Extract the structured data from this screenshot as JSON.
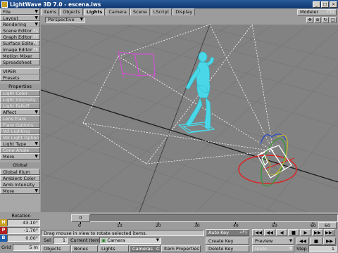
{
  "window": {
    "title": "LightWave 3D 7.0 - escena.lws",
    "buttons": [
      "_",
      "□",
      "×"
    ]
  },
  "left_panel": {
    "items": [
      {
        "label": "File",
        "arrow": "▼",
        "disabled": false
      },
      {
        "label": "Layout",
        "arrow": "▼",
        "disabled": false
      },
      {
        "label": "Rendering",
        "arrow": "▼",
        "disabled": false
      },
      {
        "label": "Scene Editor",
        "key": "F1",
        "disabled": false
      },
      {
        "label": "Graph Editor",
        "key": "F2",
        "disabled": false
      },
      {
        "label": "Surface Editor",
        "key": "F5",
        "disabled": false
      },
      {
        "label": "Image Editor",
        "key": "F6",
        "disabled": false
      },
      {
        "label": "Motion Mixer",
        "disabled": false
      },
      {
        "label": "Spreadsheet",
        "disabled": false
      }
    ],
    "items2": [
      {
        "label": "VIPER",
        "disabled": false
      },
      {
        "label": "Presets",
        "disabled": false
      }
    ],
    "properties_heading": "Properties",
    "props": [
      {
        "label": "Light Color",
        "disabled": true
      },
      {
        "label": "Light Intensity",
        "disabled": true
      },
      {
        "label": "Light Falloff",
        "disabled": true
      },
      {
        "label": "Affect",
        "arrow": "▼",
        "disabled": false
      },
      {
        "label": "Lens Flare",
        "disabled": true
      },
      {
        "label": "Flare Options",
        "disabled": true
      },
      {
        "label": "Vol Lighting",
        "disabled": true
      },
      {
        "label": "Vol Light Options",
        "disabled": true
      },
      {
        "label": "Light Type",
        "arrow": "▼",
        "disabled": false
      },
      {
        "label": "Cone Angle",
        "disabled": true
      },
      {
        "label": "More",
        "arrow": "▼",
        "disabled": false
      }
    ],
    "global_heading": "Global",
    "global": [
      {
        "label": "Global Illum",
        "disabled": false
      },
      {
        "label": "Ambient Color",
        "disabled": false
      },
      {
        "label": "Amb Intensity",
        "disabled": false
      },
      {
        "label": "More",
        "arrow": "▼",
        "disabled": false
      }
    ]
  },
  "tabs": [
    {
      "label": "Items",
      "active": false
    },
    {
      "label": "Objects",
      "active": false
    },
    {
      "label": "Lights",
      "active": true
    },
    {
      "label": "Camera",
      "active": false
    },
    {
      "label": "Scene",
      "active": false
    },
    {
      "label": "LScript",
      "active": false
    },
    {
      "label": "Display",
      "active": false
    }
  ],
  "modeler": {
    "label": "Modeler",
    "key": "F12"
  },
  "viewport": {
    "view_mode": "Perspective",
    "view_controls": [
      "move-icon",
      "zoom-icon",
      "rotate-icon",
      "maximize-icon"
    ],
    "view_glyphs": [
      "✥",
      "⊕",
      "↻",
      "□"
    ]
  },
  "timeline": {
    "rotation_label": "Rotation",
    "coords": [
      {
        "key": "H",
        "value": "43.10°",
        "color": "#c8a020"
      },
      {
        "key": "P",
        "value": "-1.70°",
        "color": "#b02020"
      },
      {
        "key": "B",
        "value": "0.00°",
        "color": "#2060b0"
      }
    ],
    "grid_label": "Grid",
    "grid_value": "5 m",
    "current_frame": "0",
    "ticks": [
      "0",
      "10",
      "20",
      "30",
      "40",
      "50",
      "60"
    ],
    "end_frame": "60",
    "status_text": "Drag mouse in view to rotate selected items.",
    "sel_label": "Sel:",
    "sel_value": "1",
    "current_item_label": "Current Item",
    "current_item_value": "Camera",
    "item_type_buttons": [
      {
        "label": "Objects",
        "active": false
      },
      {
        "label": "Bones",
        "active": false
      },
      {
        "label": "Lights",
        "active": false
      },
      {
        "label": "Cameras",
        "active": true
      }
    ],
    "cameras_key": "C",
    "item_properties": "Item Properties",
    "auto_key": "Auto Key",
    "auto_key_shortcut": "+F1",
    "create_key": "Create Key",
    "delete_key": "Delete Key",
    "preview": "Preview",
    "undo": "Undo",
    "step_label": "Step",
    "step_value": "1",
    "transport": [
      "|◀◀",
      "◀◀",
      "◀",
      "■",
      "▶",
      "▶▶",
      "▶▶|"
    ],
    "transport2": [
      "◀◀",
      "■",
      "▶▶"
    ]
  },
  "colors": {
    "title_bar": "#1a4788",
    "viewport_bg": "#828282",
    "grid_line": "#757575",
    "figure": "#4ad8e8",
    "light_cone": "#ffffff",
    "magenta_object": "#e048e0",
    "selection_ring": "#e02020"
  }
}
